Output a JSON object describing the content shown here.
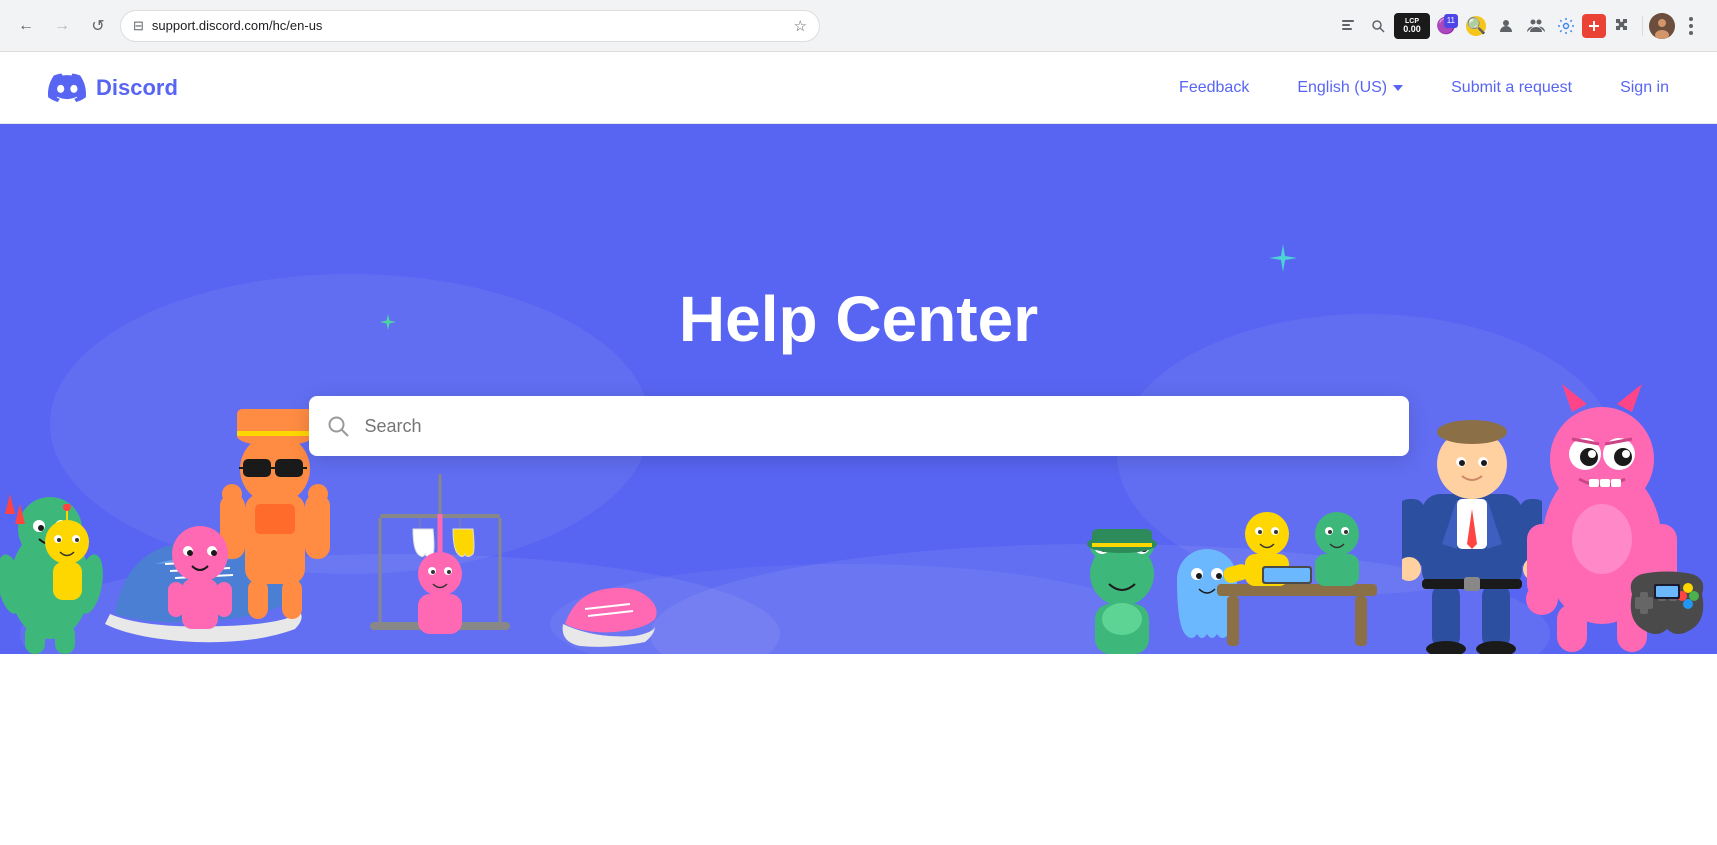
{
  "browser": {
    "url": "support.discord.com/hc/en-us",
    "nav": {
      "back_label": "←",
      "forward_label": "→",
      "refresh_label": "↺"
    },
    "toolbar_icons": [
      {
        "name": "reader-mode-icon",
        "symbol": "⊟"
      },
      {
        "name": "zoom-icon",
        "symbol": "🔍"
      },
      {
        "name": "lcp-extension-icon",
        "symbol": "LCP",
        "badge": "0.00"
      },
      {
        "name": "extension-purple-icon",
        "symbol": "⬟",
        "badge": "11"
      },
      {
        "name": "extension-yellow-icon",
        "symbol": "🔍"
      },
      {
        "name": "extension-gray-icon",
        "symbol": "👤"
      },
      {
        "name": "extension-people-icon",
        "symbol": "👥"
      },
      {
        "name": "extension-settings-icon",
        "symbol": "⚙"
      },
      {
        "name": "extension-red-icon",
        "symbol": "➕"
      },
      {
        "name": "extension-puzzle-icon",
        "symbol": "🧩"
      }
    ]
  },
  "site": {
    "logo_text": "Discord",
    "logo_aria": "Discord logo",
    "nav": {
      "feedback_label": "Feedback",
      "language_label": "English (US)",
      "submit_request_label": "Submit a request",
      "sign_in_label": "Sign in"
    }
  },
  "hero": {
    "title": "Help Center",
    "search_placeholder": "Search"
  },
  "colors": {
    "discord_blue": "#5865F2",
    "hero_bg": "#5865F2",
    "white": "#ffffff"
  }
}
